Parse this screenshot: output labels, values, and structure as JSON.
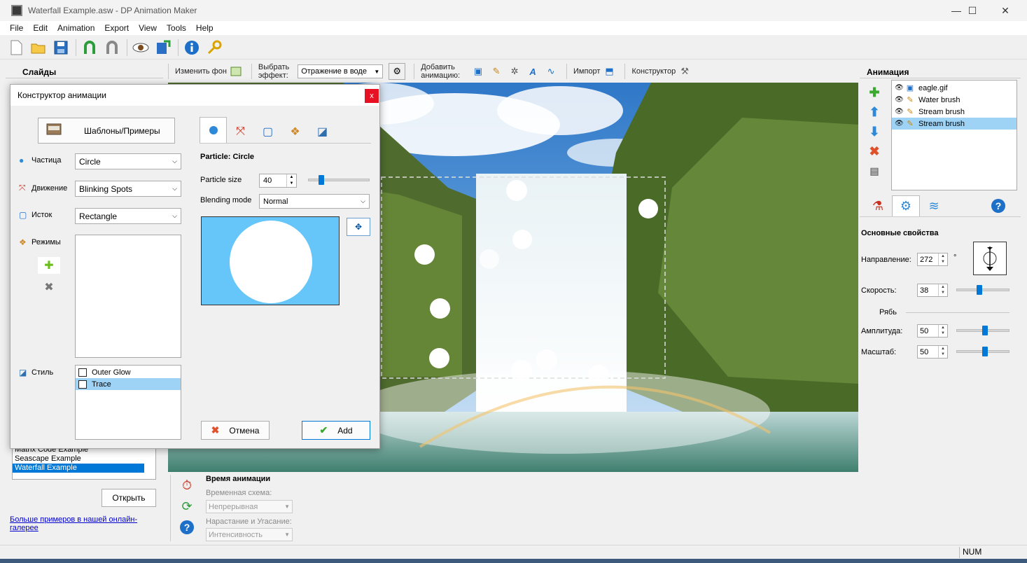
{
  "window": {
    "title": "Waterfall Example.asw - DP Animation Maker",
    "controls": [
      "—",
      "☐",
      "✕"
    ]
  },
  "menu": [
    "File",
    "Edit",
    "Animation",
    "Export",
    "View",
    "Tools",
    "Help"
  ],
  "toolbar_icons": [
    "new-icon",
    "open-icon",
    "save-icon",
    "undo-icon",
    "redo-icon",
    "preview-icon",
    "export-icon",
    "info-icon",
    "key-icon"
  ],
  "slides": {
    "title": "Слайды",
    "list": [
      "Matrix Code Example",
      "Seascape Example",
      "Waterfall Example"
    ],
    "selected": "Waterfall Example",
    "open_button": "Открыть",
    "gallery_link": "Больше примеров в нашей онлайн-галерее"
  },
  "edit_toolbar": {
    "change_bg": "Изменить фон",
    "choose_effect_1": "Выбрать",
    "choose_effect_2": "эффект:",
    "effect_value": "Отражение в воде",
    "add_anim_1": "Добавить",
    "add_anim_2": "анимацию:",
    "import": "Импорт",
    "constructor": "Конструктор"
  },
  "timing": {
    "title": "Время анимации",
    "scheme_label": "Временная схема:",
    "scheme_value": "Непрерывная",
    "fade_label": "Нарастание и Угасание:",
    "fade_value": "Интенсивность"
  },
  "animation": {
    "title": "Анимация",
    "layers": [
      {
        "name": "eagle.gif",
        "icon": "image-icon"
      },
      {
        "name": "Water brush",
        "icon": "brush-icon"
      },
      {
        "name": "Stream brush",
        "icon": "brush-icon"
      },
      {
        "name": "Stream brush",
        "icon": "brush-icon"
      }
    ],
    "selected_layer": 3,
    "props_title": "Основные свойства",
    "direction_label": "Направление:",
    "direction_value": "272",
    "degree": "°",
    "speed_label": "Скорость:",
    "speed_value": "38",
    "ripple_label": "Рябь",
    "amplitude_label": "Амплитуда:",
    "amplitude_value": "50",
    "scale_label": "Масштаб:",
    "scale_value": "50"
  },
  "dialog": {
    "title": "Конструктор анимации",
    "close": "x",
    "templates_button": "Шаблоны/Примеры",
    "particle_label": "Частица",
    "particle_value": "Circle",
    "motion_label": "Движение",
    "motion_value": "Blinking Spots",
    "source_label": "Исток",
    "source_value": "Rectangle",
    "modes_label": "Режимы",
    "style_label": "Стиль",
    "styles": [
      {
        "name": "Outer Glow",
        "checked": false
      },
      {
        "name": "Trace",
        "checked": false
      }
    ],
    "selected_style": 1,
    "particle_heading": "Particle: Circle",
    "size_label": "Particle size",
    "size_value": "40",
    "blend_label": "Blending mode",
    "blend_value": "Normal",
    "cancel": "Отмена",
    "add": "Add",
    "colors": {
      "preview_bg": "#66c6fa",
      "accent": "#0078d7"
    }
  },
  "statusbar": {
    "num": "NUM"
  }
}
